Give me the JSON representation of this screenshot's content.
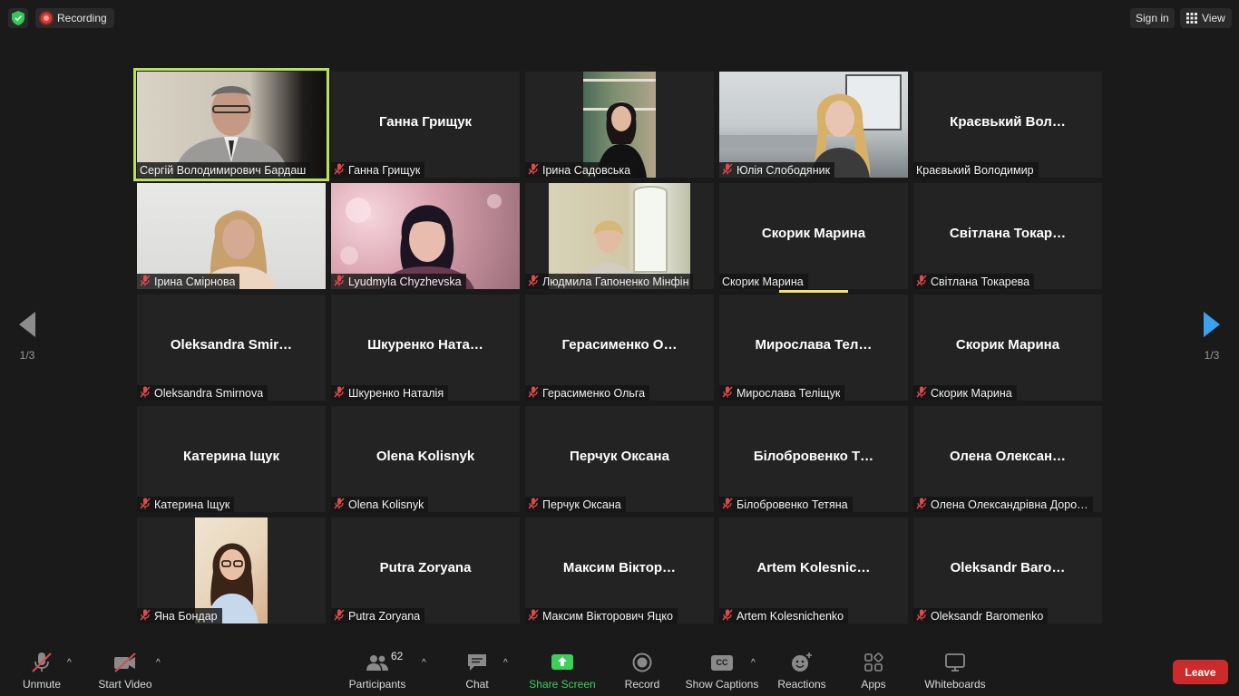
{
  "topbar": {
    "recording_label": "Recording",
    "signin_label": "Sign in",
    "view_label": "View"
  },
  "pager": {
    "left": "1/3",
    "right": "1/3"
  },
  "tiles": [
    {
      "big": "",
      "label": "Сергій Володимирович Бардаш",
      "muted": false,
      "video": "man-suit",
      "active": true
    },
    {
      "big": "Ганна Грищук",
      "label": "Ганна Грищук",
      "muted": true
    },
    {
      "big": "",
      "label": "Ірина Садовська",
      "muted": true,
      "video": "woman-bookshelf"
    },
    {
      "big": "",
      "label": "Юлія Слободяник",
      "muted": true,
      "video": "woman-office"
    },
    {
      "big": "Краєвький  Вол…",
      "label": "Краєвький Володимир",
      "muted": false
    },
    {
      "big": "",
      "label": "Ірина Смірнова",
      "muted": true,
      "video": "woman-blonde"
    },
    {
      "big": "",
      "label": "Lyudmyla Chyzhevska",
      "muted": true,
      "video": "woman-pink"
    },
    {
      "big": "",
      "label": "Людмила Гапоненко Мінфін",
      "muted": true,
      "video": "woman-window"
    },
    {
      "big": "Скорик Марина",
      "label": "Скорик Марина",
      "muted": false,
      "speaking": true
    },
    {
      "big": "Світлана  Токар…",
      "label": "Світлана Токарева",
      "muted": true
    },
    {
      "big": "Oleksandra  Smir…",
      "label": "Oleksandra Smirnova",
      "muted": true
    },
    {
      "big": "Шкуренко  Ната…",
      "label": "Шкуренко Наталія",
      "muted": true
    },
    {
      "big": "Герасименко  О…",
      "label": "Герасименко Ольга",
      "muted": true
    },
    {
      "big": "Мирослава  Тел…",
      "label": "Мирослава Теліщук",
      "muted": true
    },
    {
      "big": "Скорик Марина",
      "label": "Скорик Марина",
      "muted": true
    },
    {
      "big": "Катерина Іщук",
      "label": "Катерина Іщук",
      "muted": true
    },
    {
      "big": "Olena Kolisnyk",
      "label": "Olena Kolisnyk",
      "muted": true
    },
    {
      "big": "Перчук Оксана",
      "label": "Перчук Оксана",
      "muted": true
    },
    {
      "big": "Білобровенко  Т…",
      "label": "Білобровенко Тетяна",
      "muted": true
    },
    {
      "big": "Олена  Олексан…",
      "label": "Олена Олександрівна Доро…",
      "muted": true
    },
    {
      "big": "",
      "label": "Яна Бондар",
      "muted": true,
      "video": "woman-glasses"
    },
    {
      "big": "Putra Zoryana",
      "label": "Putra Zoryana",
      "muted": true
    },
    {
      "big": "Максим  Віктор…",
      "label": "Максим Вікторович Яцко",
      "muted": true
    },
    {
      "big": "Artem  Kolesnic…",
      "label": "Artem Kolesnichenko",
      "muted": true
    },
    {
      "big": "Oleksandr  Baro…",
      "label": "Oleksandr Baromenko",
      "muted": true
    }
  ],
  "toolbar": {
    "unmute": "Unmute",
    "start_video": "Start Video",
    "participants": "Participants",
    "participants_count": "62",
    "chat": "Chat",
    "share_screen": "Share Screen",
    "record": "Record",
    "captions": "Show Captions",
    "captions_icon_text": "CC",
    "reactions": "Reactions",
    "apps": "Apps",
    "whiteboards": "Whiteboards",
    "leave": "Leave"
  },
  "colors": {
    "accent_green": "#3ecf5a",
    "active_speaker": "#b8e05a",
    "leave_red": "#cc2b2b",
    "mute_red": "#e04a4a"
  }
}
